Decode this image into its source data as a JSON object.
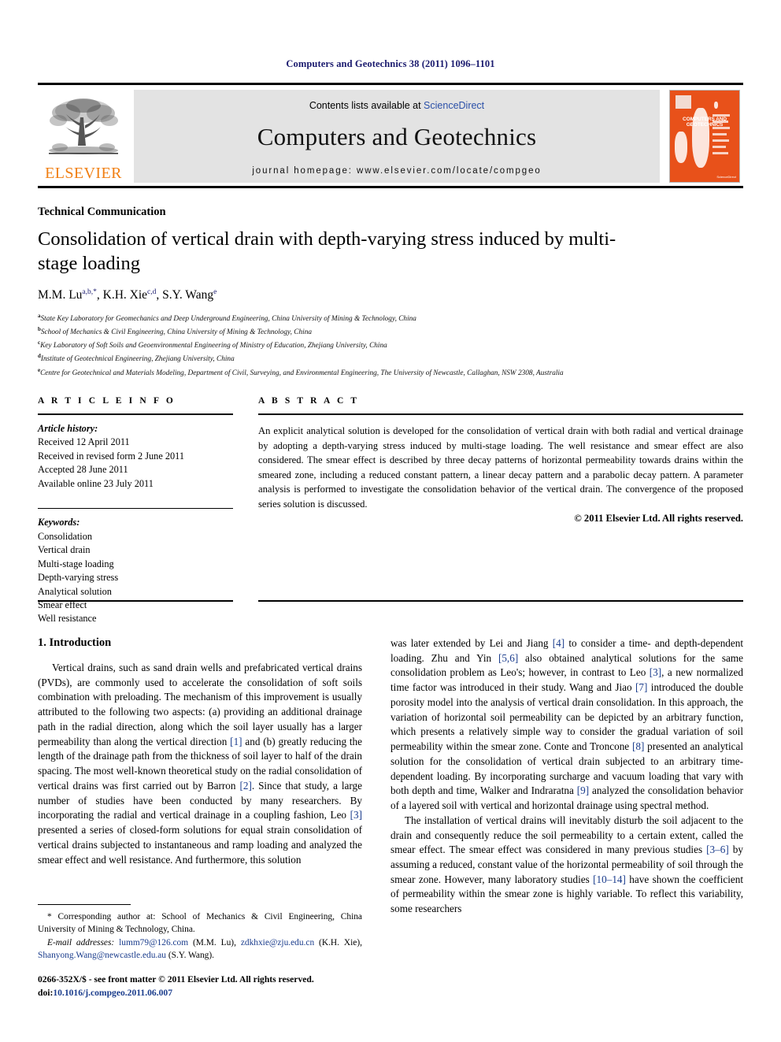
{
  "running_head": "Computers and Geotechnics 38 (2011) 1096–1101",
  "masthead": {
    "contents_prefix": "Contents lists available at ",
    "sciencedirect": "ScienceDirect",
    "journal_title": "Computers and Geotechnics",
    "homepage": "journal homepage: www.elsevier.com/locate/compgeo",
    "publisher_name": "ELSEVIER",
    "cover_title": "COMPUTERS AND GEOTECHNICS",
    "cover_footer": "ScienceDirect",
    "cover_color": "#E8511A",
    "link_color": "#2b50a8"
  },
  "article": {
    "category": "Technical Communication",
    "title": "Consolidation of vertical drain with depth-varying stress induced by multi-stage loading",
    "authors": [
      {
        "name": "M.M. Lu",
        "sup": "a,b,*"
      },
      {
        "name": "K.H. Xie",
        "sup": "c,d"
      },
      {
        "name": "S.Y. Wang",
        "sup": "e"
      }
    ],
    "affiliations": [
      {
        "marker": "a",
        "text": "State Key Laboratory for Geomechanics and Deep Underground Engineering, China University of Mining & Technology, China"
      },
      {
        "marker": "b",
        "text": "School of Mechanics & Civil Engineering, China University of Mining & Technology, China"
      },
      {
        "marker": "c",
        "text": "Key Laboratory of Soft Soils and Geoenvironmental Engineering of Ministry of Education, Zhejiang University, China"
      },
      {
        "marker": "d",
        "text": "Institute of Geotechnical Engineering, Zhejiang University, China"
      },
      {
        "marker": "e",
        "text": "Centre for Geotechnical and Materials Modeling, Department of Civil, Surveying, and Environmental Engineering, The University of Newcastle, Callaghan, NSW 2308, Australia"
      }
    ]
  },
  "article_info": {
    "heading": "A R T I C L E   I N F O",
    "history_label": "Article history:",
    "history": [
      "Received 12 April 2011",
      "Received in revised form 2 June 2011",
      "Accepted 28 June 2011",
      "Available online 23 July 2011"
    ],
    "keywords_label": "Keywords:",
    "keywords": [
      "Consolidation",
      "Vertical drain",
      "Multi-stage loading",
      "Depth-varying stress",
      "Analytical solution",
      "Smear effect",
      "Well resistance"
    ]
  },
  "abstract": {
    "heading": "A B S T R A C T",
    "text": "An explicit analytical solution is developed for the consolidation of vertical drain with both radial and vertical drainage by adopting a depth-varying stress induced by multi-stage loading. The well resistance and smear effect are also considered. The smear effect is described by three decay patterns of horizontal permeability towards drains within the smeared zone, including a reduced constant pattern, a linear decay pattern and a parabolic decay pattern. A parameter analysis is performed to investigate the consolidation behavior of the vertical drain. The convergence of the proposed series solution is discussed.",
    "copyright": "© 2011 Elsevier Ltd. All rights reserved."
  },
  "introduction": {
    "section_number_title": "1. Introduction",
    "left_para_1_a": "Vertical drains, such as sand drain wells and prefabricated vertical drains (PVDs), are commonly used to accelerate the consolidation of soft soils combination with preloading. The mechanism of this improvement is usually attributed to the following two aspects: (a) providing an additional drainage path in the radial direction, along which the soil layer usually has a larger permeability than along the vertical direction ",
    "left_cite_1": "[1]",
    "left_para_1_b": " and (b) greatly reducing the length of the drainage path from the thickness of soil layer to half of the drain spacing. The most well-known theoretical study on the radial consolidation of vertical drains was first carried out by Barron ",
    "left_cite_2": "[2]",
    "left_para_1_c": ". Since that study, a large number of studies have been conducted by many researchers. By incorporating the radial and vertical drainage in a coupling fashion, Leo ",
    "left_cite_3": "[3]",
    "left_para_1_d": " presented a series of closed-form solutions for equal strain consolidation of vertical drains subjected to instantaneous and ramp loading and analyzed the smear effect and well resistance. And furthermore, this solution",
    "right_para_1_a": "was later extended by Lei and Jiang ",
    "right_cite_4": "[4]",
    "right_para_1_b": " to consider a time- and depth-dependent loading. Zhu and Yin ",
    "right_cite_56": "[5,6]",
    "right_para_1_c": " also obtained analytical solutions for the same consolidation problem as Leo's; however, in contrast to Leo ",
    "right_cite_3": "[3]",
    "right_para_1_d": ", a new normalized time factor was introduced in their study. Wang and Jiao ",
    "right_cite_7": "[7]",
    "right_para_1_e": " introduced the double porosity model into the analysis of vertical drain consolidation. In this approach, the variation of horizontal soil permeability can be depicted by an arbitrary function, which presents a relatively simple way to consider the gradual variation of soil permeability within the smear zone. Conte and Troncone ",
    "right_cite_8": "[8]",
    "right_para_1_f": " presented an analytical solution for the consolidation of vertical drain subjected to an arbitrary time-dependent loading. By incorporating surcharge and vacuum loading that vary with both depth and time, Walker and Indraratna ",
    "right_cite_9": "[9]",
    "right_para_1_g": " analyzed the consolidation behavior of a layered soil with vertical and horizontal drainage using spectral method.",
    "right_para_2_a": "The installation of vertical drains will inevitably disturb the soil adjacent to the drain and consequently reduce the soil permeability to a certain extent, called the smear effect. The smear effect was considered in many previous studies ",
    "right_cite_36": "[3–6]",
    "right_para_2_b": " by assuming a reduced, constant value of the horizontal permeability of soil through the smear zone. However, many laboratory studies ",
    "right_cite_1014": "[10–14]",
    "right_para_2_c": " have shown the coefficient of permeability within the smear zone is highly variable. To reflect this variability, some researchers"
  },
  "footnote": {
    "star": "*",
    "corresponding": " Corresponding author at: School of Mechanics & Civil Engineering, China University of Mining & Technology, China.",
    "email_label": "E-mail addresses:",
    "email_1": "lumm79@126.com",
    "email_1_owner": " (M.M. Lu), ",
    "email_2": "zdkhxie@zju.edu.cn",
    "email_2_owner": " (K.H. Xie), ",
    "email_3": "Shanyong.Wang@newcastle.edu.au",
    "email_3_owner": " (S.Y. Wang)."
  },
  "imprint": {
    "issn_line": "0266-352X/$ - see front matter © 2011 Elsevier Ltd. All rights reserved.",
    "doi_label": "doi:",
    "doi_value": "10.1016/j.compgeo.2011.06.007"
  }
}
